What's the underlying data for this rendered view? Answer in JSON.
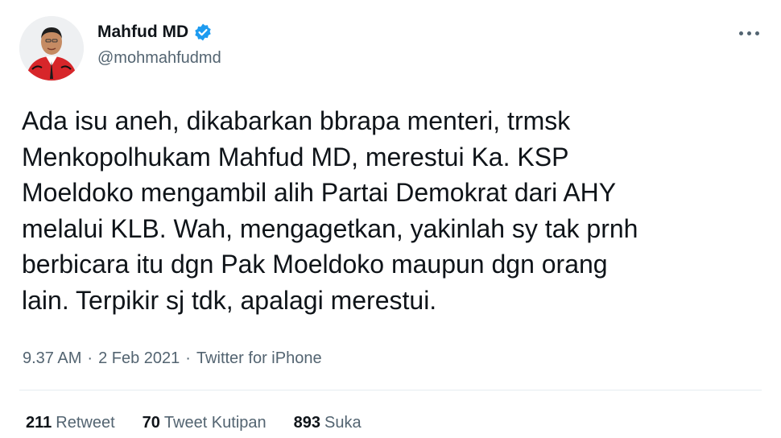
{
  "author": {
    "name": "Mahfud MD",
    "handle": "@mohmahfudmd",
    "verified": true,
    "avatar": "avatar-photo"
  },
  "tweet": {
    "text": "Ada isu aneh, dikabarkan bbrapa menteri, trmsk\nMenkopolhukam Mahfud MD, merestui Ka. KSP\nMoeldoko mengambil alih Partai Demokrat dari AHY\nmelalui KLB. Wah, mengagetkan, yakinlah sy tak prnh\nberbicara itu dgn Pak Moeldoko maupun dgn orang\nlain. Terpikir sj tdk, apalagi merestui.",
    "time": "9.37 AM",
    "separator": "·",
    "date": "2 Feb 2021",
    "source": "Twitter for iPhone"
  },
  "stats": {
    "retweets": {
      "count": "211",
      "label": "Retweet"
    },
    "quotes": {
      "count": "70",
      "label": "Tweet Kutipan"
    },
    "likes": {
      "count": "893",
      "label": "Suka"
    }
  },
  "icons": {
    "verified": "verified-badge-icon",
    "more": "more-options-icon"
  },
  "colors": {
    "text": "#0f1419",
    "secondary": "#536471",
    "verified": "#1d9bf0"
  }
}
